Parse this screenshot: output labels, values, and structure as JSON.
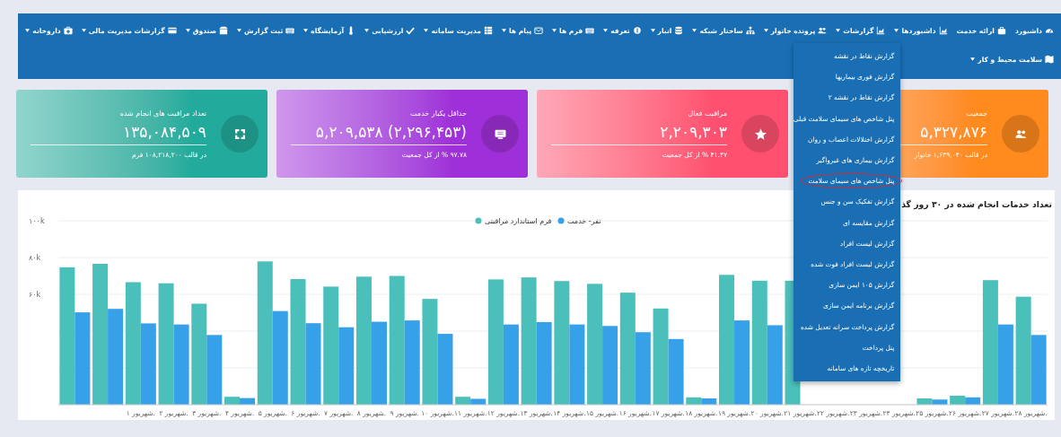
{
  "menu_bar": {
    "rows": [
      [
        {
          "label": "داشبورد",
          "dropdown": false
        },
        {
          "label": "ارائه خدمت",
          "dropdown": false
        },
        {
          "label": "داشبوردها",
          "dropdown": true
        },
        {
          "label": "گزارشات",
          "dropdown": true,
          "submenu": [
            {
              "label": "گزارش نقاط در نقشه",
              "circled": false
            },
            {
              "label": "گزارش فوری بیماریها",
              "circled": false
            },
            {
              "label": "گزارش نقاط در نقشه ۲",
              "circled": false
            },
            {
              "label": "پنل شاخص های سیمای سلامت قبلی",
              "circled": false
            },
            {
              "label": "گزارش اختلالات اعصاب و روان",
              "circled": false
            },
            {
              "label": "گزارش بیماری های غیرواگیر",
              "circled": false
            },
            {
              "label": "پنل شاخص های سیمای سلامت",
              "circled": true
            },
            {
              "label": "گزارش تفکیک سن و جنس",
              "circled": false
            },
            {
              "label": "گزارش مقایسه ای",
              "circled": false
            },
            {
              "label": "گزارش لیست افراد",
              "circled": false
            },
            {
              "label": "گزارش لیست افراد فوت شده",
              "circled": false
            },
            {
              "label": "گزارش ۱۰۵ ایمن سازی",
              "circled": false
            },
            {
              "label": "گزارش برنامه ایمن سازی",
              "circled": false
            },
            {
              "label": "گزارش پرداخت سرانه تعدیل شده",
              "circled": false
            },
            {
              "label": "پنل پرداخت",
              "circled": false
            },
            {
              "label": "تاریخچه تازه های سامانه",
              "circled": false
            }
          ]
        },
        {
          "label": "پرونده خانوار",
          "dropdown": true
        },
        {
          "label": "ساختار شبکه",
          "dropdown": true
        },
        {
          "label": "انبار",
          "dropdown": true
        },
        {
          "label": "تعرفه",
          "dropdown": true
        },
        {
          "label": "فرم ها",
          "dropdown": true
        },
        {
          "label": "پیام ها",
          "dropdown": true
        },
        {
          "label": "مدیریت سامانه",
          "dropdown": true
        },
        {
          "label": "ارزشیابی",
          "dropdown": true
        },
        {
          "label": "آزمایشگاه",
          "dropdown": true
        },
        {
          "label": "ثبت گزارش",
          "dropdown": true
        },
        {
          "label": "صندوق",
          "dropdown": true
        },
        {
          "label": "گزارشات مدیریت مالی",
          "dropdown": true
        },
        {
          "label": "داروخانه",
          "dropdown": true
        }
      ],
      [
        {
          "label": "سلامت محیط و کار",
          "dropdown": true
        }
      ]
    ]
  },
  "stat_cards": [
    {
      "title": "جمعیت",
      "value": "۵,۳۲۷,۸۷۶",
      "note": "در قالب ۱,۶۳۹,۰۴۰ خانوار",
      "color": "#ff8a1e"
    },
    {
      "title": "مراقبت فعال",
      "value": "۲,۲۰۹,۳۰۳",
      "note": "۴۱.۴۷ % از کل جمعیت",
      "color": "#ff5070"
    },
    {
      "title": "حداقل یکبار خدمت",
      "value": "(۲,۲۹۶,۴۵۳) ۵,۲۰۹,۵۳۸",
      "note": "۹۷.۷۸ % از کل جمعیت",
      "color": "#9f2fd8"
    },
    {
      "title": "تعداد مراقبت های انجام شده",
      "value": "۱۳۵,۰۸۴,۵۰۹",
      "note": "در قالب ۱۰۸,۲۱۸,۲۰۰ فرم",
      "color": "#22ab9c"
    }
  ],
  "chart": {
    "title": "تعداد خدمات انجام شده در ۳۰ روز گذ",
    "chart_data": {
      "type": "bar",
      "categories": [
        null,
        null,
        "شهریور ۱.",
        "شهریور ۲.",
        "شهریور ۳.",
        "شهریور ۴.",
        "شهریور ۵.",
        "شهریور ۶.",
        "شهریور ۷.",
        "شهریور ۸.",
        "شهریور ۹.",
        "شهریور ۱۰.",
        "شهریور ۱۱.",
        "شهریور ۱۲.",
        "شهریور ۱۳.",
        "شهریور ۱۴.",
        "شهریور ۱۵.",
        "شهریور ۱۶.",
        "شهریور ۱۷.",
        "شهریور ۱۸.",
        "شهریور ۱۹.",
        "شهریور ۲۰.",
        "شهریور ۲۱.",
        "شهریور ۲۲.",
        "شهریور ۲۳.",
        "شهریور ۲۴.",
        "شهریور ۲۵.",
        "شهریور ۲۶.",
        "شهریور ۲۷.",
        "شهریور ۲۸."
      ],
      "series": [
        {
          "name": "فرم استاندارد مراقبتی",
          "color": "#4bbfba",
          "values": [
            74.7,
            76.6,
            66.6,
            66,
            54.9,
            4.3,
            77.9,
            68.3,
            64.2,
            69.6,
            70,
            57.5,
            4.3,
            68.1,
            69.2,
            67.2,
            65.7,
            60.9,
            52.3,
            4,
            70.6,
            67.4,
            67.4,
            null,
            null,
            null,
            3.4,
            4.9,
            67.7,
            58.7
          ]
        },
        {
          "name": "نفر- خدمت",
          "color": "#36a0e8",
          "values": [
            50.2,
            52.1,
            44.2,
            43.6,
            37.9,
            3.6,
            50.9,
            44.3,
            42.1,
            45.1,
            45.8,
            38.5,
            3.2,
            43.6,
            44.9,
            43.6,
            42.8,
            39.4,
            35.7,
            3.4,
            45.8,
            43.2,
            null,
            null,
            null,
            null,
            2.8,
            4,
            43.6,
            37.9
          ]
        }
      ],
      "legend": true,
      "ylim": [
        0,
        100
      ],
      "yticks": [
        {
          "value": 60,
          "label": "۶۰k"
        },
        {
          "value": 80,
          "label": "۸۰k"
        },
        {
          "value": 100,
          "label": "۱۰۰k"
        }
      ]
    }
  }
}
